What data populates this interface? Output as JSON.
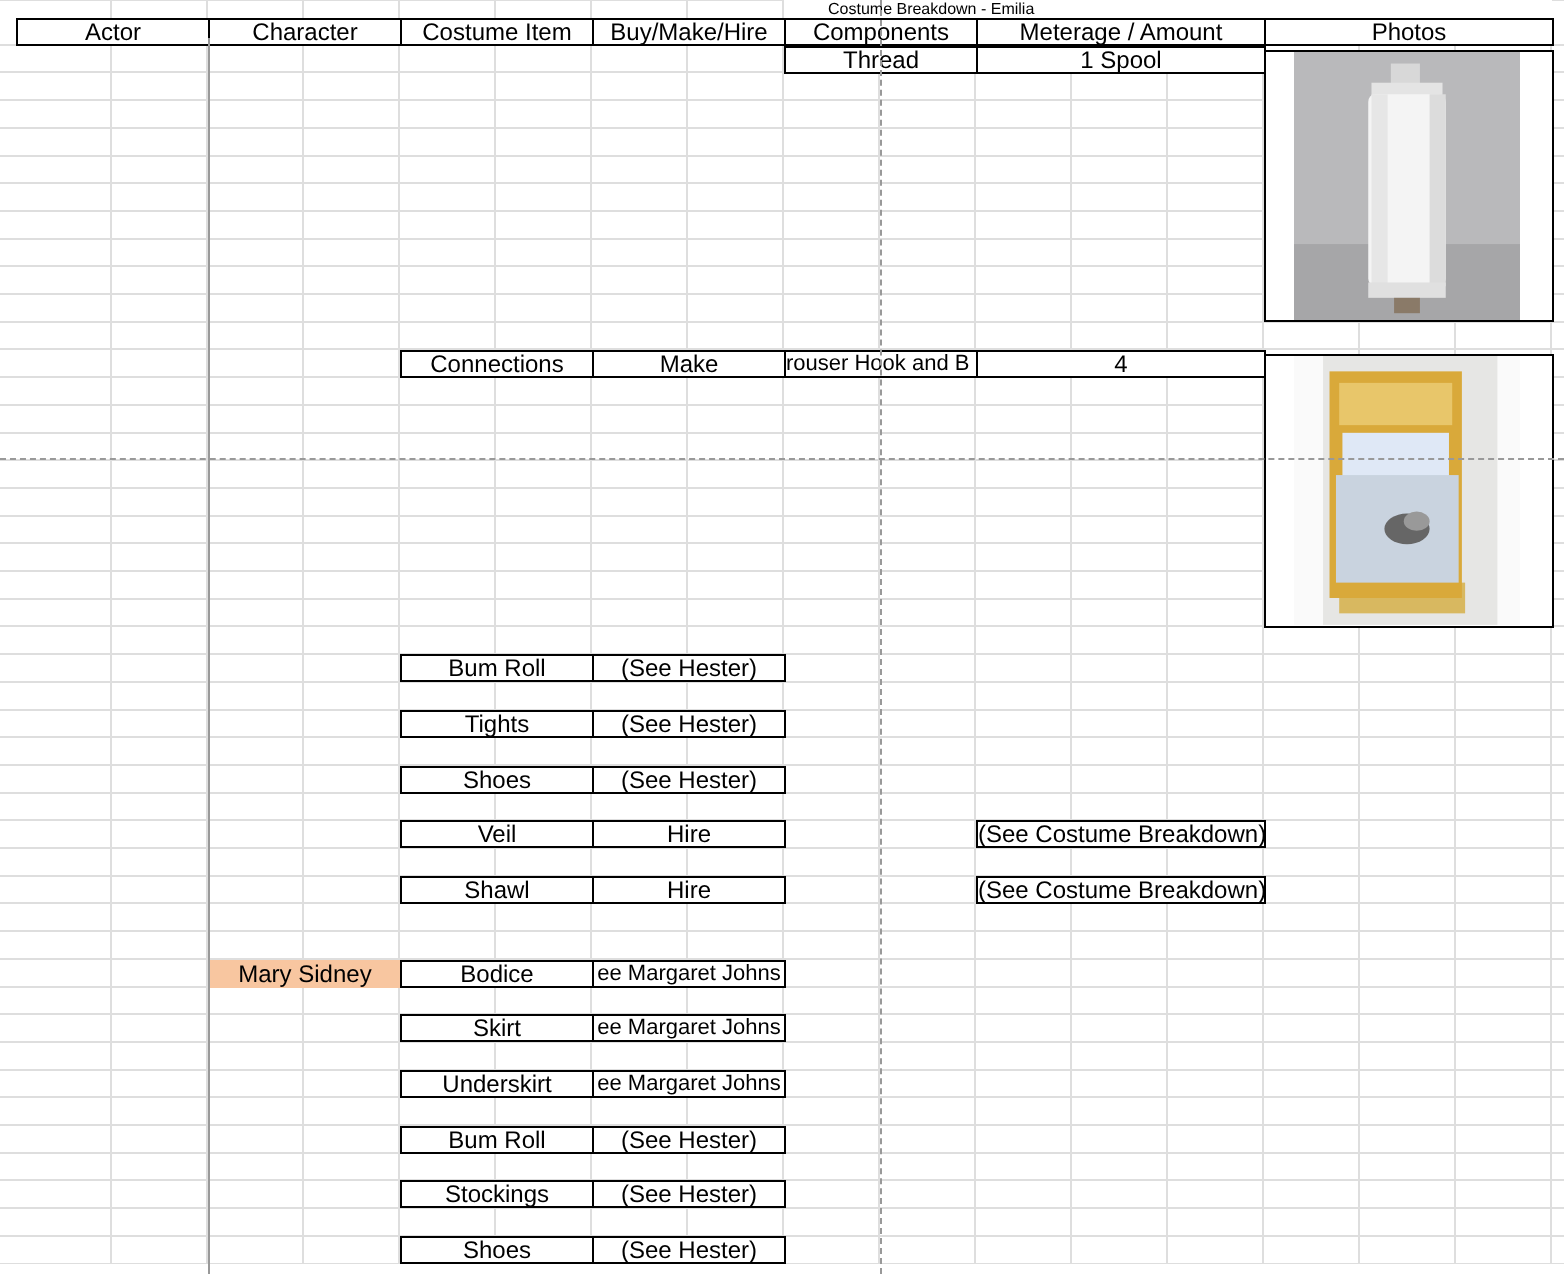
{
  "title": "Costume Breakdown - Emilia",
  "columns": [
    "Actor",
    "Character",
    "Costume Item",
    "Buy/Make/Hire",
    "Components",
    "Meterage / Amount",
    "Photos"
  ],
  "rows": [
    {
      "components": "Thread",
      "meterage_amount": "1 Spool"
    },
    {
      "costume_item": "Connections",
      "buy_make_hire": "Make",
      "components": "rouser Hook and B",
      "meterage_amount": "4"
    },
    {
      "costume_item": "Bum Roll",
      "buy_make_hire": "(See Hester)"
    },
    {
      "costume_item": "Tights",
      "buy_make_hire": "(See Hester)"
    },
    {
      "costume_item": "Shoes",
      "buy_make_hire": "(See Hester)"
    },
    {
      "costume_item": "Veil",
      "buy_make_hire": "Hire",
      "meterage_amount": "(See Costume Breakdown)"
    },
    {
      "costume_item": "Shawl",
      "buy_make_hire": "Hire",
      "meterage_amount": "(See Costume Breakdown)"
    },
    {
      "character": {
        "text": "Mary Sidney",
        "highlighted": true
      },
      "costume_item": "Bodice",
      "buy_make_hire": "ee Margaret Johns"
    },
    {
      "costume_item": "Skirt",
      "buy_make_hire": "ee Margaret Johns"
    },
    {
      "costume_item": "Underskirt",
      "buy_make_hire": "ee Margaret Johns"
    },
    {
      "costume_item": "Bum Roll",
      "buy_make_hire": "(See Hester)"
    },
    {
      "costume_item": "Stockings",
      "buy_make_hire": "(See Hester)"
    },
    {
      "costume_item": "Shoes",
      "buy_make_hire": "(See Hester)"
    }
  ]
}
